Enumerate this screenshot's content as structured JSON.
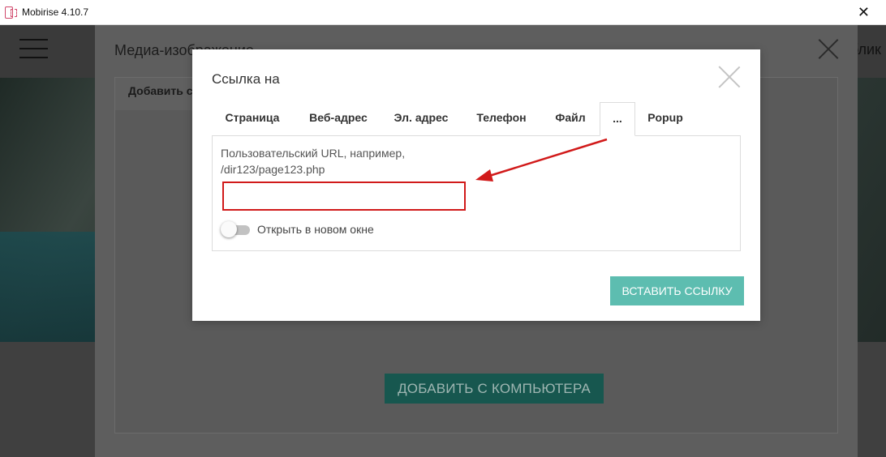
{
  "window": {
    "app_title": "Mobirise 4.10.7",
    "close_glyph": "✕"
  },
  "background": {
    "right_partial_text": "блик",
    "media_dialog": {
      "title": "Медиа-изображение",
      "tab_label": "Добавить с",
      "upload_button": "ДОБАВИТЬ С КОМПЬЮТЕРА"
    }
  },
  "link_dialog": {
    "title": "Ссылка на",
    "tabs": [
      {
        "label": "Страница",
        "active": false
      },
      {
        "label": "Веб-адрес",
        "active": false
      },
      {
        "label": "Эл. адрес",
        "active": false
      },
      {
        "label": "Телефон",
        "active": false
      },
      {
        "label": "Файл",
        "active": false
      },
      {
        "label": "...",
        "active": true
      },
      {
        "label": "Popup",
        "active": false
      }
    ],
    "hint_line1": "Пользовательский URL, например,",
    "hint_line2": "/dir123/page123.php",
    "url_value": "",
    "url_placeholder": "",
    "toggle_label": "Открыть в новом окне",
    "toggle_on": false,
    "insert_button": "ВСТАВИТЬ ССЫЛКУ"
  },
  "colors": {
    "accent": "#5dbdb0",
    "highlight": "#d11a1a",
    "upload_button": "#17574f"
  },
  "icons": {
    "app": "mobirise-logo-icon",
    "dialog_close": "close-x-icon",
    "menu": "hamburger-menu-icon"
  }
}
